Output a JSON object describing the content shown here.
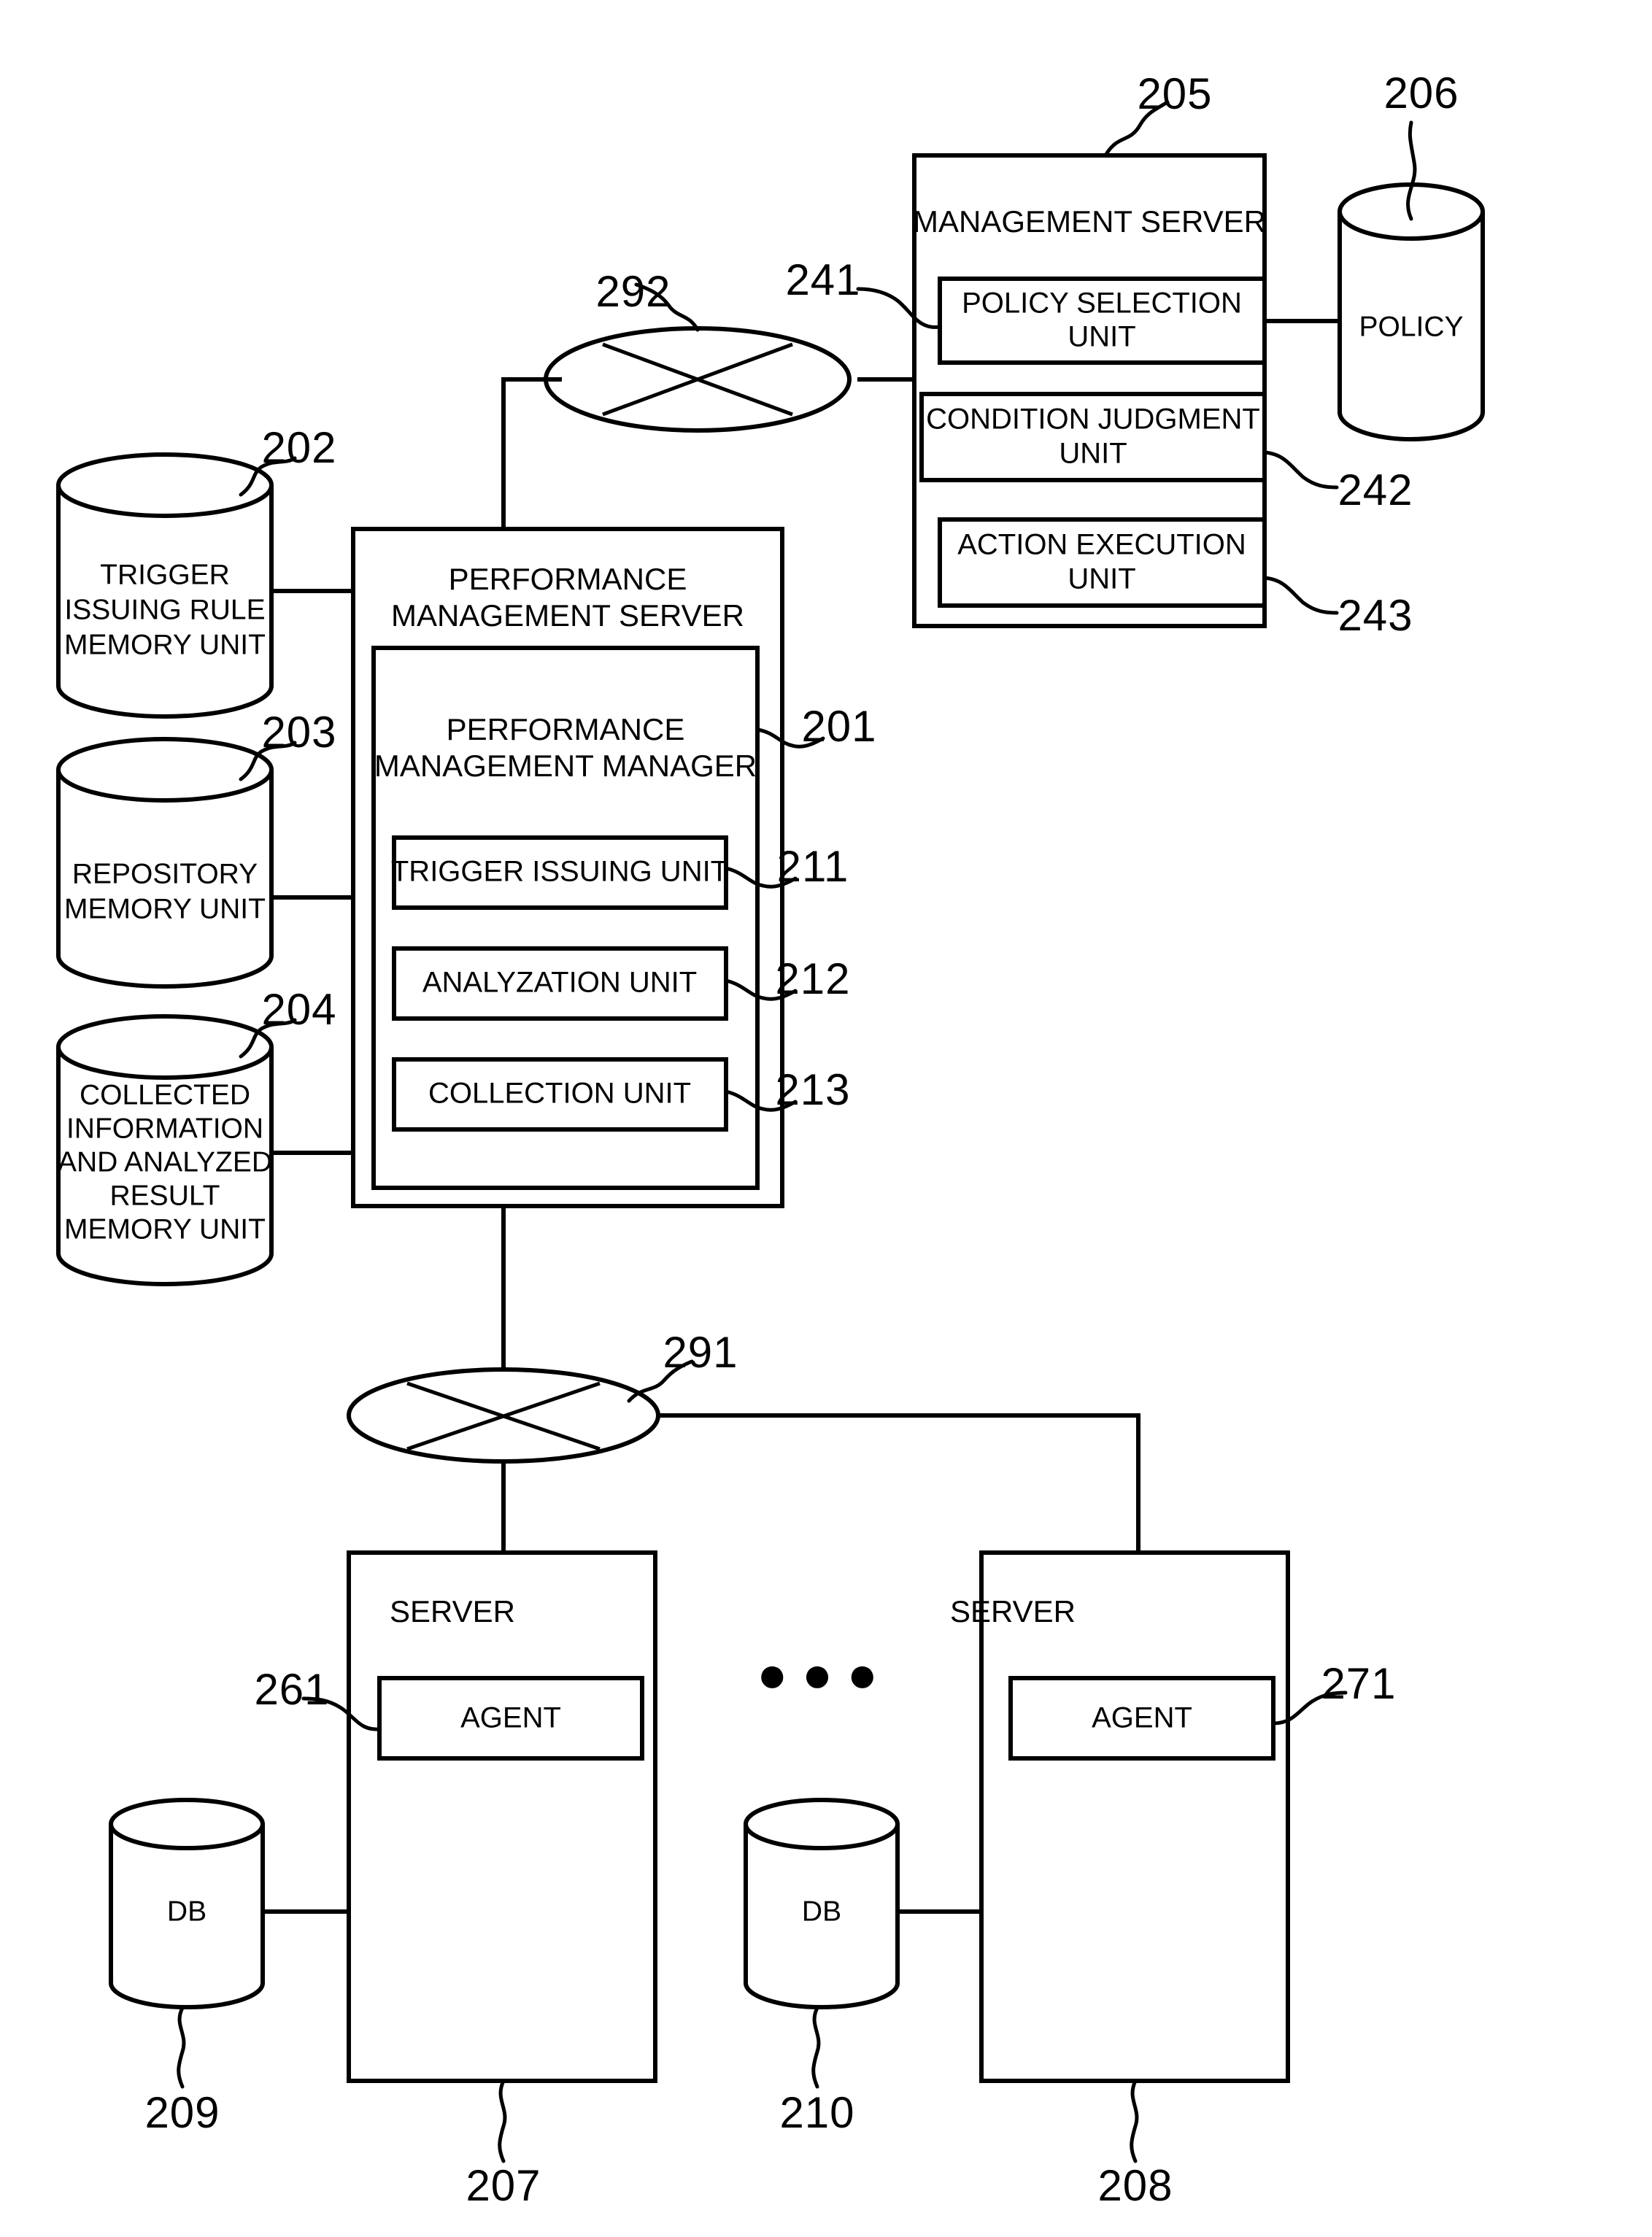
{
  "figure": {
    "type": "patent-block-diagram",
    "background_color": "#ffffff",
    "line_color": "#000000"
  },
  "management_server": {
    "title": "MANAGEMENT SERVER",
    "ref": "205",
    "units": [
      {
        "label_line1": "POLICY SELECTION",
        "label_line2": "UNIT",
        "ref": "241"
      },
      {
        "label_line1": "CONDITION JUDGMENT",
        "label_line2": "UNIT",
        "ref": "242"
      },
      {
        "label_line1": "ACTION EXECUTION",
        "label_line2": "UNIT",
        "ref": "243"
      }
    ]
  },
  "policy_store": {
    "label": "POLICY",
    "ref": "206"
  },
  "performance_management_server": {
    "title_line1": "PERFORMANCE",
    "title_line2": "MANAGEMENT SERVER",
    "manager": {
      "title_line1": "PERFORMANCE",
      "title_line2": "MANAGEMENT MANAGER",
      "ref": "201",
      "units": [
        {
          "label": "TRIGGER ISSUING UNIT",
          "ref": "211"
        },
        {
          "label": "ANALYZATION UNIT",
          "ref": "212"
        },
        {
          "label": "COLLECTION UNIT",
          "ref": "213"
        }
      ]
    }
  },
  "memory_units": [
    {
      "ref": "202",
      "lines": [
        "TRIGGER",
        "ISSUING RULE",
        "MEMORY UNIT"
      ]
    },
    {
      "ref": "203",
      "lines": [
        "REPOSITORY",
        "MEMORY UNIT"
      ]
    },
    {
      "ref": "204",
      "lines": [
        "COLLECTED",
        "INFORMATION",
        "AND ANALYZED",
        "RESULT",
        "MEMORY UNIT"
      ]
    }
  ],
  "networks": [
    {
      "ref": "292",
      "name": "management-network"
    },
    {
      "ref": "291",
      "name": "agent-network"
    }
  ],
  "servers": [
    {
      "title": "SERVER",
      "ref": "207",
      "agent": {
        "label": "AGENT",
        "ref": "261"
      },
      "database": {
        "label": "DB",
        "ref": "209"
      }
    },
    {
      "title": "SERVER",
      "ref": "208",
      "agent": {
        "label": "AGENT",
        "ref": "271"
      },
      "database": {
        "label": "DB",
        "ref": "210"
      }
    }
  ],
  "ellipsis": "● ● ●"
}
